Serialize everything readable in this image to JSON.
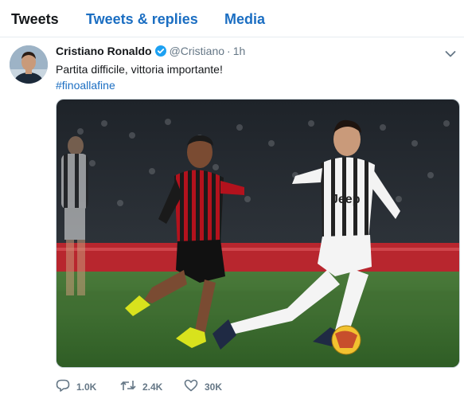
{
  "tabs": [
    {
      "label": "Tweets",
      "active": true
    },
    {
      "label": "Tweets & replies",
      "active": false
    },
    {
      "label": "Media",
      "active": false
    }
  ],
  "tweet": {
    "author_name": "Cristiano Ronaldo",
    "verified_icon": "verified-badge-icon",
    "handle": "@Cristiano",
    "separator": "·",
    "time": "1h",
    "text": "Partita difficile, vittoria importante!",
    "hashtag": "#finoallafine",
    "media_jersey_text": "Jeep",
    "actions": {
      "reply_count": "1.0K",
      "retweet_count": "2.4K",
      "like_count": "30K"
    }
  },
  "icons": {
    "reply": "reply-icon",
    "retweet": "retweet-icon",
    "like": "heart-icon",
    "more": "chevron-down-icon"
  },
  "colors": {
    "accent": "#1b6ec2",
    "verified": "#1da1f2",
    "secondary_text": "#657786",
    "divider": "#e6ecf0"
  }
}
